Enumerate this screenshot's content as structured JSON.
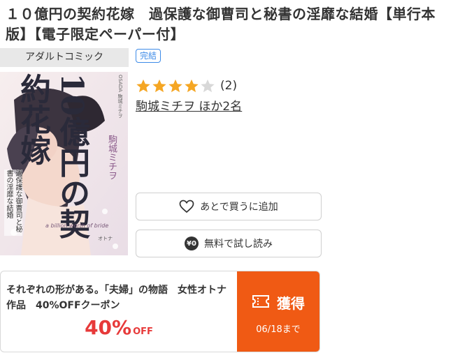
{
  "product": {
    "title": "１０億円の契約花嫁　過保護な御曹司と秘書の淫靡な結婚【単行本版】【電子限定ペーパー付】",
    "genre": "アダルトコミック",
    "status_badge": "完結"
  },
  "cover": {
    "title_text": "10億円の契約花嫁",
    "subtitle_text": "過保護な御曹司と秘書の淫靡な結婚",
    "author_text": "駒城ミチヲ",
    "english_text": "a billion worth of bride",
    "side_small_text": "OSADA 駒城ミチヲ",
    "publisher_text": "オトナ",
    "accent_color": "#9a6a8a"
  },
  "rating": {
    "value": 4,
    "max": 5,
    "count": "(2)",
    "filled_color": "#f5a623",
    "empty_color": "#d8d8d8"
  },
  "author": {
    "label": "駒城ミチヲ ほか2名"
  },
  "actions": {
    "wishlist_label": "あとで買うに追加",
    "wishlist_icon": "heart-outline-icon",
    "trial_label": "無料で試し読み",
    "trial_icon_text": "¥0"
  },
  "coupon": {
    "description": "それぞれの形がある。「夫婦」の物語　女性オトナ作品　40%OFFクーポン",
    "discount_value": "40%",
    "discount_suffix": "OFF",
    "get_label": "獲得",
    "deadline": "06/18まで",
    "accent_color": "#f05a14",
    "discount_color": "#e73a3a"
  }
}
